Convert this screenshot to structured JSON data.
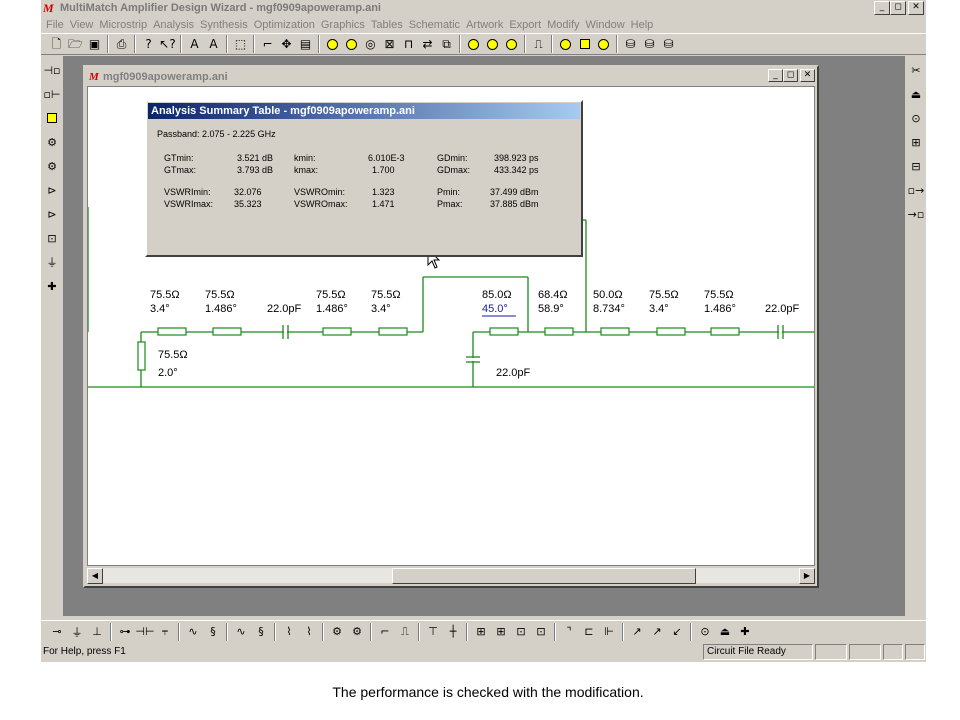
{
  "app": {
    "logo": "M",
    "title": "MultiMatch Amplifier Design Wizard - mgf0909apoweramp.ani",
    "title_buttons": [
      "_",
      "◻",
      "✕"
    ]
  },
  "menu": [
    "File",
    "View",
    "Microstrip",
    "Analysis",
    "Synthesis",
    "Optimization",
    "Graphics",
    "Tables",
    "Schematic",
    "Artwork",
    "Export",
    "Modify",
    "Window",
    "Help"
  ],
  "toolbar": {
    "icons": [
      "new-file-icon",
      "open-folder-icon",
      "save-icon",
      "print-icon",
      "help-icon",
      "context-help-icon",
      "tune-a-icon",
      "tune-b-icon",
      "select-tool-icon",
      "connect-tool-icon",
      "move-tool-icon",
      "text-tool-icon"
    ]
  },
  "child_window": {
    "logo": "M",
    "title": "mgf0909apoweramp.ani",
    "buttons": [
      "_",
      "◻",
      "✕"
    ]
  },
  "summary": {
    "title": "Analysis Summary Table - mgf0909apoweramp.ani",
    "passband": "Passband: 2.075 - 2.225 GHz",
    "rows": [
      [
        "GTmin:",
        "3.521 dB",
        "kmin:",
        "6.010E-3",
        "GDmin:",
        "398.923 ps"
      ],
      [
        "GTmax:",
        "3.793 dB",
        "kmax:",
        "1.700",
        "GDmax:",
        "433.342 ps"
      ],
      [
        "VSWRImin:",
        "32.076",
        "VSWROmin:",
        "1.323",
        "Pmin:",
        "37.499 dBm"
      ],
      [
        "VSWRImax:",
        "35.323",
        "VSWROmax:",
        "1.471",
        "Pmax:",
        "37.885 dBm"
      ]
    ]
  },
  "schematic": {
    "labels": [
      {
        "id": "tl1",
        "z": "75.5Ω",
        "deg": "3.4°"
      },
      {
        "id": "tl2",
        "z": "75.5Ω",
        "deg": "1.486°"
      },
      {
        "id": "c1",
        "z": "22.0pF"
      },
      {
        "id": "tl3",
        "z": "75.5Ω",
        "deg": "1.486°"
      },
      {
        "id": "tl4",
        "z": "75.5Ω",
        "deg": "3.4°"
      },
      {
        "id": "tl5",
        "z": "85.0Ω",
        "deg": "45.0°"
      },
      {
        "id": "tl6",
        "z": "68.4Ω",
        "deg": "58.9°"
      },
      {
        "id": "tl7",
        "z": "50.0Ω",
        "deg": "8.734°"
      },
      {
        "id": "tl8",
        "z": "75.5Ω",
        "deg": "3.4°"
      },
      {
        "id": "tl9",
        "z": "75.5Ω",
        "deg": "1.486°"
      },
      {
        "id": "c2",
        "z": "22.0pF"
      },
      {
        "id": "stub",
        "z": "75.5Ω",
        "deg": "2.0°"
      },
      {
        "id": "c3",
        "z": "22.0pF"
      }
    ],
    "wire_color": "#1a8a1a"
  },
  "status": {
    "help": "For Help, press F1",
    "file_state": "Circuit File Ready"
  },
  "caption": "The performance is checked with the modification."
}
